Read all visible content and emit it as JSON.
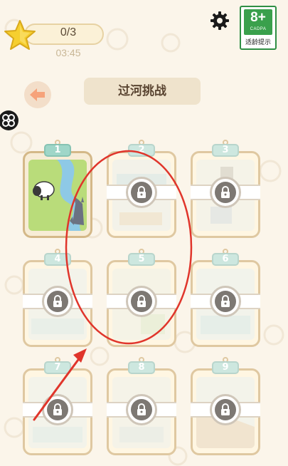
{
  "header": {
    "progress_text": "0/3",
    "timer_text": "03:45",
    "age_rating": {
      "number": "8+",
      "org": "CADPA",
      "label": "适龄提示"
    }
  },
  "title": "过河挑战",
  "levels": [
    {
      "number": "1",
      "locked": false
    },
    {
      "number": "2",
      "locked": true
    },
    {
      "number": "3",
      "locked": true
    },
    {
      "number": "4",
      "locked": true
    },
    {
      "number": "5",
      "locked": true
    },
    {
      "number": "6",
      "locked": true
    },
    {
      "number": "7",
      "locked": true
    },
    {
      "number": "8",
      "locked": true
    },
    {
      "number": "9",
      "locked": true
    }
  ],
  "icons": {
    "star": "star-icon",
    "settings": "gear-icon",
    "back": "back-arrow-icon",
    "lock": "lock-icon",
    "side": "menu-icon"
  },
  "colors": {
    "background": "#fbf5ea",
    "annotation_red": "#e0352b",
    "age_green": "#3aa04c",
    "star_yellow": "#f6cf2f"
  }
}
